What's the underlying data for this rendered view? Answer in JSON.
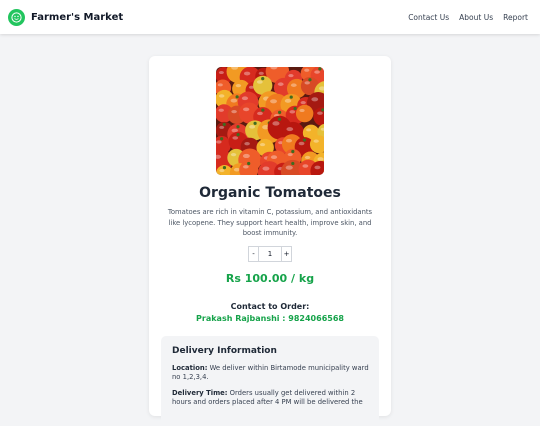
{
  "navbar": {
    "brand": "Farmer's Market",
    "logo_icon": "smiley-icon",
    "links": [
      "Contact Us",
      "About Us",
      "Report"
    ],
    "accent": "#22c55e"
  },
  "product": {
    "title": "Organic Tomatoes",
    "description": "Tomatoes are rich in vitamin C, potassium, and antioxidants like lycopene. They support heart health, improve skin, and boost immunity.",
    "quantity": {
      "decrement_label": "-",
      "value": "1",
      "increment_label": "+"
    },
    "price": "Rs 100.00 / kg",
    "price_color": "#16a34a"
  },
  "contact": {
    "label": "Contact to Order:",
    "value": "Prakash Rajbanshi : 9824066568"
  },
  "delivery": {
    "title": "Delivery Information",
    "location_label": "Location:",
    "location_text": " We deliver within Birtamode municipality ward no 1,2,3,4.",
    "time_label": "Delivery Time:",
    "time_text": " Orders usually get delivered within 2 hours and orders placed after 4 PM will be delivered the"
  }
}
